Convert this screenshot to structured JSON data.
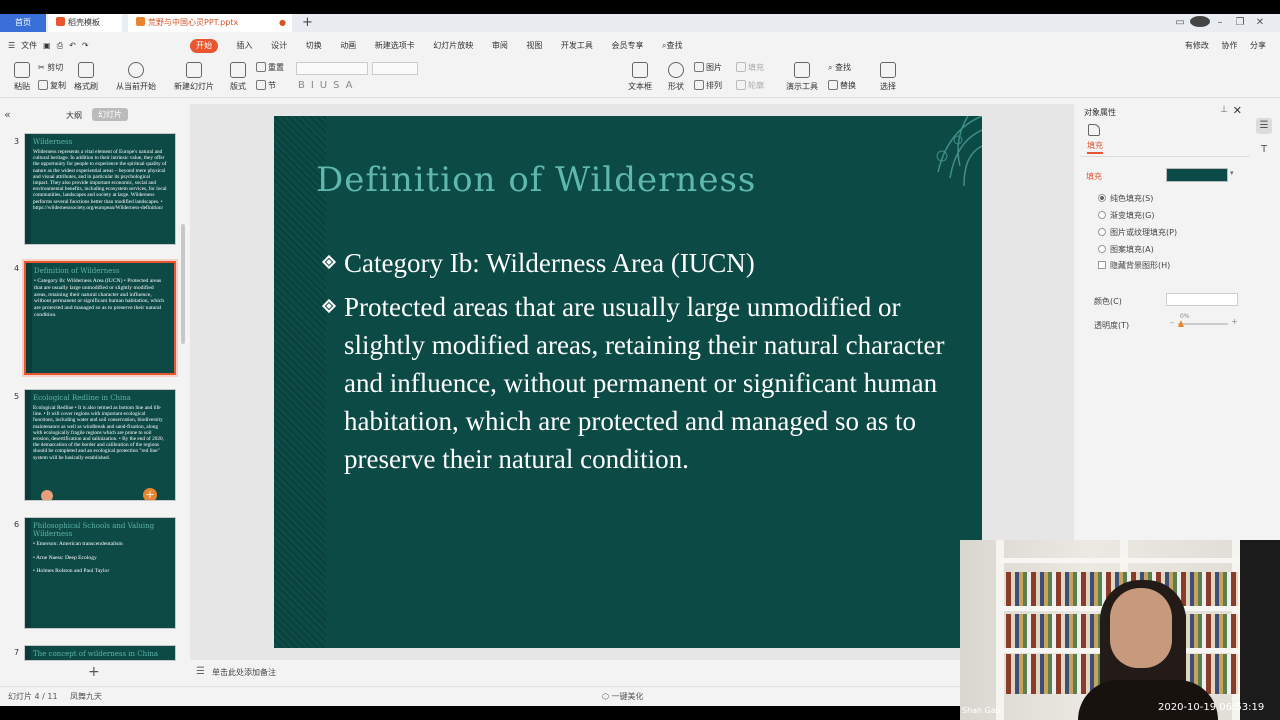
{
  "titlebar": {
    "home_tab": "首页",
    "template_tab": "稻壳模板",
    "doc_tab": "荒野与中国心灵PPT.pptx",
    "tab_close": "●",
    "new_tab": "+"
  },
  "menubar": {
    "file": "文件",
    "tabs": [
      "开始",
      "插入",
      "设计",
      "切换",
      "动画",
      "新建选项卡",
      "幻灯片放映",
      "审阅",
      "视图",
      "开发工具",
      "会员专享",
      "查找"
    ],
    "right": [
      "有修改",
      "协作",
      "分享"
    ]
  },
  "ribbon": {
    "paste": "粘贴",
    "cut": "剪切",
    "copy": "复制",
    "format_painter": "格式刷",
    "play_from_current": "从当前开始",
    "new_slide": "新建幻灯片",
    "layout": "版式",
    "section": "节",
    "reset": "重置",
    "textbox": "文本框",
    "shape": "形状",
    "arrange": "排列",
    "picture": "图片",
    "fill": "填充",
    "outline": "轮廓",
    "present_tools": "演示工具",
    "find": "查找",
    "replace": "替换",
    "select": "选择"
  },
  "left_panel": {
    "outline_tab": "大纲",
    "slides_tab": "幻灯片",
    "thumbs": [
      {
        "num": "3",
        "title": "Wilderness",
        "body": "Wilderness represents a vital element of Europe's natural and cultural heritage. In addition to their intrinsic value, they offer the opportunity for people to experience the spiritual quality of nature as the widest experiential areas – beyond mere physical and visual attributes, and in particular its psychological impact. They also provide important economic, social and environmental benefits, including ecosystem services, for local communities, landscapes and society at large. Wilderness performs several functions better than modified landscapes. • https://wildernesssociety.org/european/Wilderness-definition/"
      },
      {
        "num": "4",
        "title": "Definition of Wilderness",
        "body": "• Category Ib: Wilderness Area (IUCN) • Protected areas that are usually large unmodified or slightly modified areas, retaining their natural character and influence, without permanent or significant human habitation, which are protected and managed so as to preserve their natural condition."
      },
      {
        "num": "5",
        "title": "Ecological Redline in China",
        "body": "Ecological Redline • It is also termed as bottom line and life line. • It will cover regions with important ecological functions, including water and soil conservation, biodiversity maintenance as well as windbreak and sand-fixation, along with ecologically fragile regions which are prone to soil erosion, desertification and salinization. • By the end of 2020, the demarcation of the border and calibration of the regions should be completed and an ecological protection \"red line\" system will be basically established."
      },
      {
        "num": "6",
        "title": "Philosophical Schools and Valuing Wilderness",
        "body": "• Emerson: American transcendentalism\n\n• Arne Naess: Deep Ecology\n\n• Holmes Rolston and Paul Taylor"
      },
      {
        "num": "7",
        "title": "The concept of wilderness in China",
        "body": ""
      }
    ]
  },
  "slide": {
    "title": "Definition of Wilderness",
    "bullets": [
      "Category Ib: Wilderness Area  (IUCN)",
      "Protected areas that are usually large unmodified or slightly modified areas, retaining their natural character and influence, without permanent or significant human habitation, which are protected and managed so as to preserve their natural condition."
    ],
    "background_color": "#0c4a46",
    "title_color": "#5fb8ad"
  },
  "notes": {
    "placeholder": "单击此处添加备注"
  },
  "right_panel": {
    "title": "对象属性",
    "fill_tab": "填充",
    "fill_label": "填充",
    "fill_color": "#0b4a46",
    "options": [
      "纯色填充(S)",
      "渐变填充(G)",
      "图片或纹理填充(P)",
      "图案填充(A)"
    ],
    "hide_bg": "隐藏背景图形(H)",
    "color_label": "颜色(C)",
    "transparency_label": "透明度(T)",
    "transparency_value": "0%"
  },
  "statusbar": {
    "slide_count": "幻灯片 4 / 11",
    "theme": "凤舞九天",
    "beautify": "一键美化"
  },
  "webcam": {
    "name": "Shan Gao",
    "timestamp": "2020-10-19  06:53:19"
  }
}
